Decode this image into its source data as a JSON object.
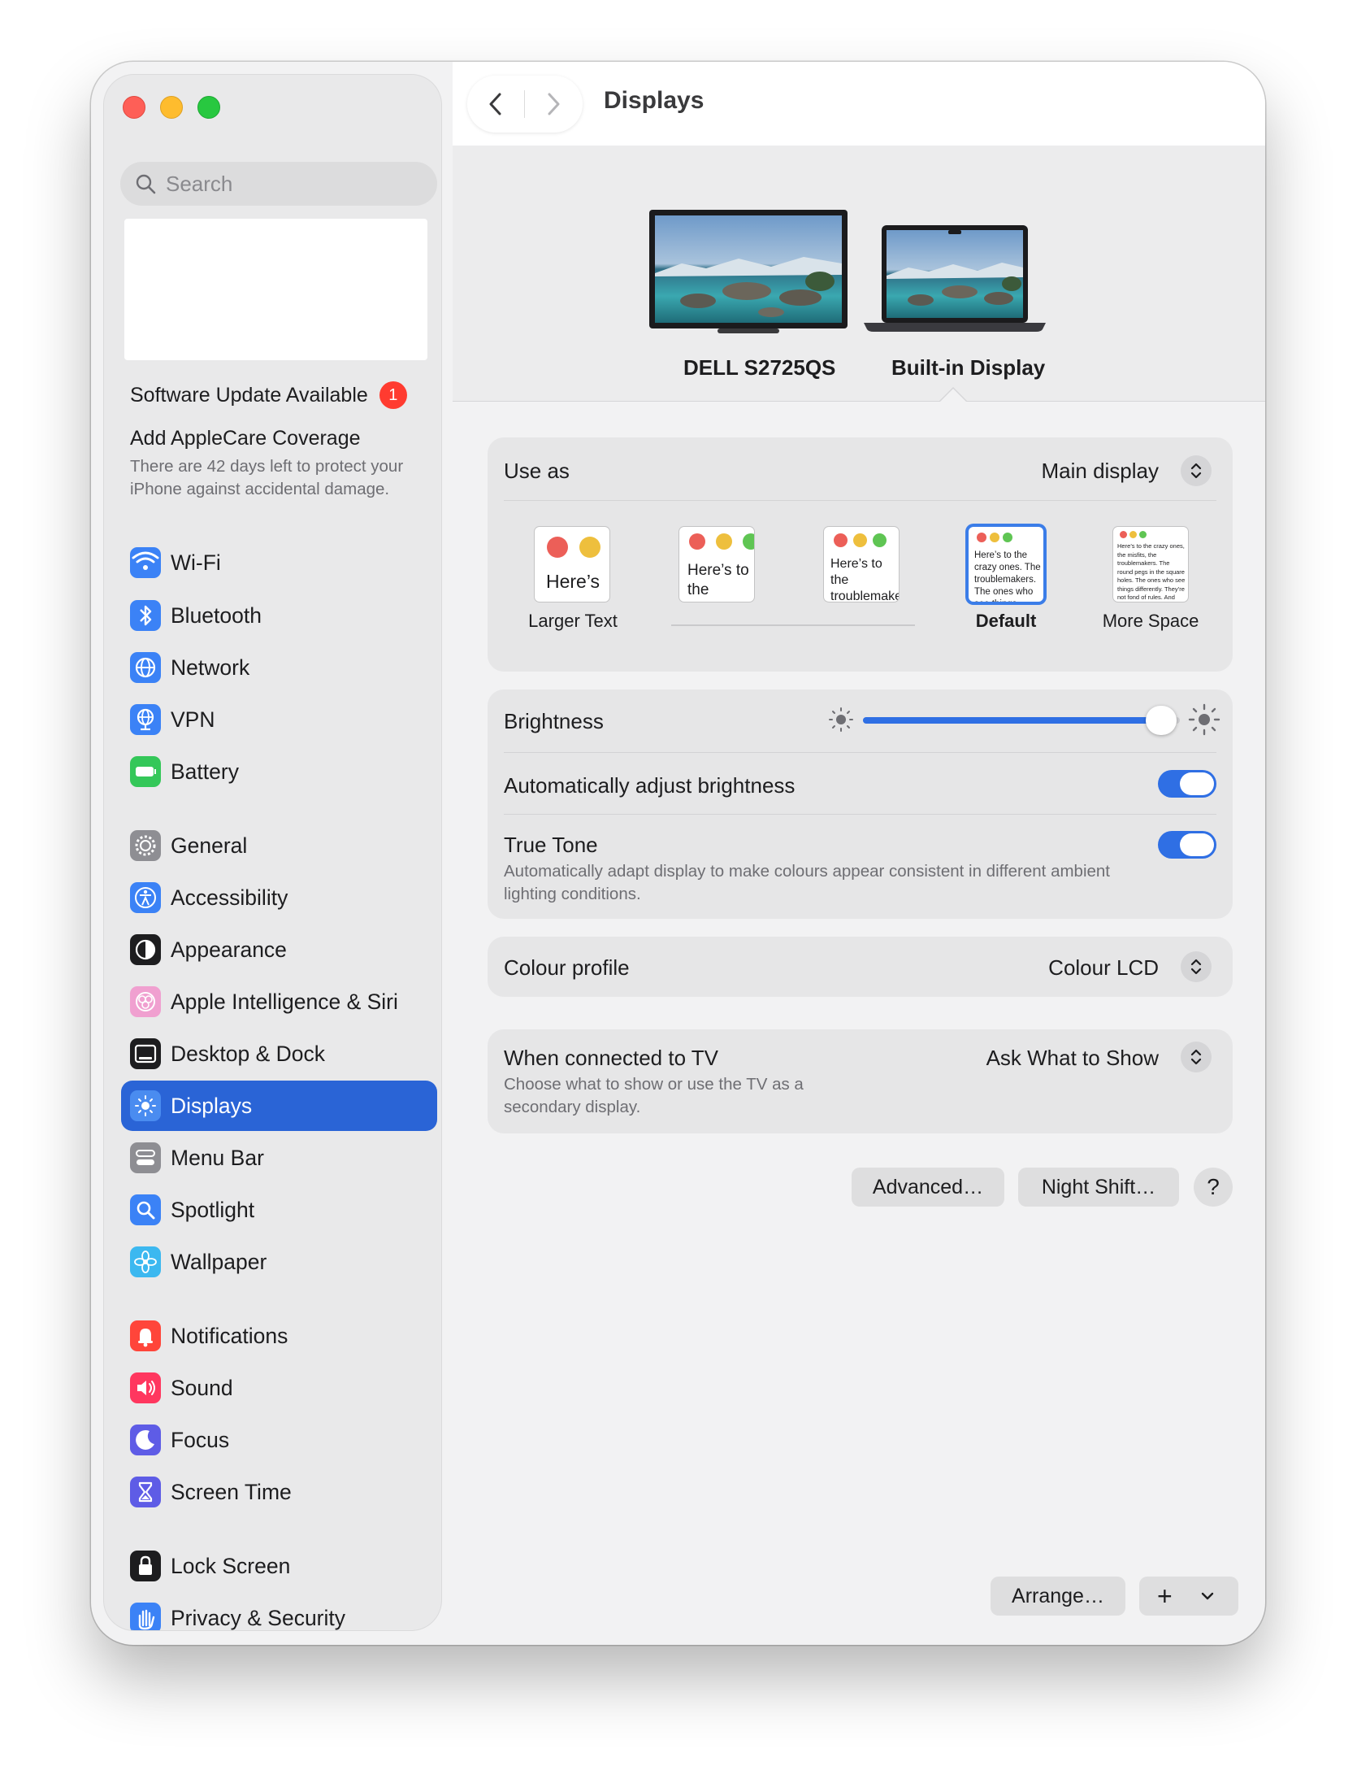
{
  "sidebar": {
    "search_placeholder": "Search",
    "software_update": {
      "label": "Software Update Available",
      "badge": "1"
    },
    "applecare": {
      "title": "Add AppleCare Coverage",
      "description": "There are 42 days left to protect your iPhone against accidental damage."
    },
    "items": [
      {
        "label": "Wi-Fi",
        "icon": "wifi-icon",
        "color": "#3b82f6"
      },
      {
        "label": "Bluetooth",
        "icon": "bluetooth-icon",
        "color": "#3b82f6"
      },
      {
        "label": "Network",
        "icon": "globe-icon",
        "color": "#3b82f6"
      },
      {
        "label": "VPN",
        "icon": "vpn-globe-icon",
        "color": "#3b82f6"
      },
      {
        "label": "Battery",
        "icon": "battery-icon",
        "color": "#34c759"
      },
      {
        "label": "General",
        "icon": "gear-icon",
        "color": "#8e8e93"
      },
      {
        "label": "Accessibility",
        "icon": "accessibility-icon",
        "color": "#3b82f6"
      },
      {
        "label": "Appearance",
        "icon": "appearance-icon",
        "color": "#1d1d1f"
      },
      {
        "label": "Apple Intelligence & Siri",
        "icon": "siri-icon",
        "color": "#f0a0d0"
      },
      {
        "label": "Desktop & Dock",
        "icon": "dock-icon",
        "color": "#1d1d1f"
      },
      {
        "label": "Displays",
        "icon": "sun-icon",
        "color": "#3b82f6",
        "selected": true
      },
      {
        "label": "Menu Bar",
        "icon": "menubar-icon",
        "color": "#8e8e93"
      },
      {
        "label": "Spotlight",
        "icon": "magnifier-icon",
        "color": "#3b82f6"
      },
      {
        "label": "Wallpaper",
        "icon": "flower-icon",
        "color": "#3cb8f0"
      },
      {
        "label": "Notifications",
        "icon": "bell-icon",
        "color": "#ff453a"
      },
      {
        "label": "Sound",
        "icon": "speaker-icon",
        "color": "#ff375f"
      },
      {
        "label": "Focus",
        "icon": "moon-icon",
        "color": "#5e5ce6"
      },
      {
        "label": "Screen Time",
        "icon": "hourglass-icon",
        "color": "#5e5ce6"
      },
      {
        "label": "Lock Screen",
        "icon": "lock-icon",
        "color": "#1d1d1f"
      },
      {
        "label": "Privacy & Security",
        "icon": "hand-icon",
        "color": "#3b82f6"
      }
    ]
  },
  "header": {
    "title": "Displays"
  },
  "displays": [
    {
      "name": "DELL S2725QS",
      "icon": "external-monitor-icon"
    },
    {
      "name": "Built-in Display",
      "icon": "laptop-icon",
      "selected": true
    }
  ],
  "settings": {
    "use_as": {
      "label": "Use as",
      "value": "Main display"
    },
    "resolution": {
      "options": [
        {
          "label": "Larger Text",
          "preview": "Here’s"
        },
        {
          "label": "",
          "preview": "Here’s to the troublemakers"
        },
        {
          "label": "",
          "preview": "Here’s to the troublemakers. The ones who"
        },
        {
          "label": "Default",
          "preview": "Here’s to the crazy ones. The troublemakers. The ones who see things differently. They’re not fond of rules. And they",
          "selected": true
        },
        {
          "label": "More Space",
          "preview": "Here’s to the crazy ones, the misfits, the troublemakers. The round pegs in the square holes. The ones who see things differently. They’re not fond of rules. And they have no respect for the status quo. You can quote them, disagree with them, glorify or vilify them. About the only thing you can’t do is ignore them. Because they change things."
        }
      ]
    },
    "brightness": {
      "label": "Brightness",
      "value": 0.94
    },
    "auto_brightness": {
      "label": "Automatically adjust brightness",
      "on": true
    },
    "true_tone": {
      "label": "True Tone",
      "description": "Automatically adapt display to make colours appear consistent in different ambient lighting conditions.",
      "on": true
    },
    "colour_profile": {
      "label": "Colour profile",
      "value": "Colour LCD"
    },
    "tv": {
      "label": "When connected to TV",
      "description": "Choose what to show or use the TV as a secondary display.",
      "value": "Ask What to Show"
    }
  },
  "buttons": {
    "advanced": "Advanced…",
    "night_shift": "Night Shift…",
    "help": "?",
    "arrange": "Arrange…",
    "add": "+"
  },
  "colors": {
    "accent": "#2f6fe4",
    "selected_sidebar": "#2a64d6"
  }
}
